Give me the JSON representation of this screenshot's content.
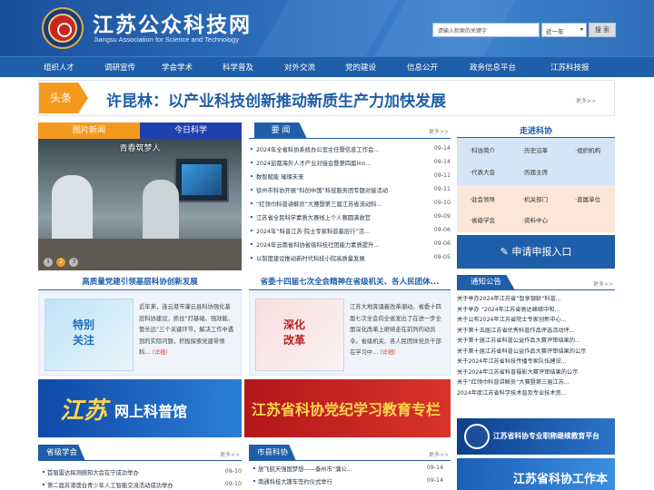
{
  "header": {
    "title": "江苏公众科技网",
    "subtitle": "Jiangsu Association for Science and Technology",
    "search_placeholder": "请输入检索的关键字",
    "search_range": "近一年",
    "search_button": "搜 索"
  },
  "nav": [
    "组织人才",
    "调研宣传",
    "学会学术",
    "科学普及",
    "对外交流",
    "党的建设",
    "信息公开",
    "政务信息平台",
    "江苏科技报"
  ],
  "headline": {
    "tag": "头条",
    "text": "许昆林：以产业科技创新推动新质生产力加快发展",
    "more": "更多>>"
  },
  "photo_tabs": {
    "a": "图片新闻",
    "b": "今日科学"
  },
  "photo": {
    "caption": "青春筑梦人",
    "dots": [
      "1",
      "2",
      "3"
    ]
  },
  "news": {
    "title": "要 闻",
    "more": "更多>>",
    "items": [
      {
        "t": "2024年全省科协系统办公室主任暨信息工作会...",
        "d": "09-14"
      },
      {
        "t": "2024盐都海外人才产业对接会暨第四届Inn...",
        "d": "09-14"
      },
      {
        "t": "数智赋能 璀璨未来",
        "d": "09-11"
      },
      {
        "t": "徐州市科协开展“科创中国”科技服务团专题对接活动",
        "d": "09-11"
      },
      {
        "t": "“红领巾科普讲解员”大赛暨第三届江苏省流动科...",
        "d": "09-10"
      },
      {
        "t": "江苏省全民科学素质大赛线上个人赛圆满收官",
        "d": "09-09"
      },
      {
        "t": "2024年“科普江苏·院士专家科普基层行”活...",
        "d": "09-06"
      },
      {
        "t": "2024年云南省科协省级科技社团能力素质提升...",
        "d": "09-06"
      },
      {
        "t": "以制度建设推动新时代科技小院高质量发展",
        "d": "09-05"
      }
    ]
  },
  "zjkx": {
    "title": "走进科协",
    "blue": [
      "·科协简介",
      "·历史沿革",
      "·组织机构",
      "·代表大会",
      "·历届主席"
    ],
    "peach": [
      "·驻会领导",
      "·机关部门",
      "·直属单位",
      "·省级学会",
      "·资料中心"
    ],
    "apply": "申请申报入口"
  },
  "promo1": {
    "title": "高质量党建引领基层科协创新发展",
    "img_label_1": "特别",
    "img_label_2": "关注",
    "text": "近年来，连云港市灌云县科协强化基层科协建设，抓住“打基础、强效能、管长远”三个关键环节，解决工作中遇到的实际问题，积极探索党建带领科...",
    "link": "(详细)"
  },
  "promo2": {
    "title": "省委十四届七次全会精神在省级机关、各人民团体...",
    "img_label_1": "深化",
    "img_label_2": "改革",
    "text": "江苏大地奔涌着改革潮动。省委十四届七次全会向全省发出了在进一步全面深化改革上继续走在前列的动员令。省级机关、各人民团体党员干部在学习中...",
    "link": "(详细)"
  },
  "banner1": {
    "big": "江苏",
    "rest": "网上科普馆"
  },
  "banner2": {
    "text": "江苏省科协党纪学习教育专栏"
  },
  "notice": {
    "title": "通知公告",
    "more": "更多>>",
    "items": [
      "关于举办2024年江苏省“智享银龄”科普...",
      "关于举办 “2024年江苏省驰达峰碳中和...",
      "关于公布2024年江苏省院士专家创新中心...",
      "关于第十五届江苏省优秀科普作品评选活动评...",
      "关于第十届江苏省科普公益作品大赛评审结果的...",
      "关于第十届江苏省科普公益作品大赛评审结果的公示",
      "关于2024年江苏省科技传播专家队伍建设...",
      "关于2024年江苏省科普摄影大赛评审结果的公示",
      "关于“红领巾科普讲解员”大赛暨第三届江苏...",
      "2024年度江苏省科学技术普及专业技术资..."
    ]
  },
  "jq_banner": {
    "text": "江苏省科协专业职称继续教育平台"
  },
  "jq_banner2": {
    "text": "江苏省科协工作本"
  },
  "xhxh": {
    "title": "省级学会",
    "more": "更多>>",
    "items": [
      {
        "t": "首届雷达探测感知大会在宁成功举办",
        "d": "09-10"
      },
      {
        "t": "第二届苏港澳台青少年人工智能交流活动成功举办",
        "d": "09-10"
      }
    ]
  },
  "sxkx": {
    "title": "市县科协",
    "more": "更多>>",
    "items": [
      {
        "t": "放飞航天强国梦想——泰州市“蒲公...",
        "d": "09-14"
      },
      {
        "t": "南通科技大篷车签约仪式举行",
        "d": "09-14"
      }
    ]
  }
}
